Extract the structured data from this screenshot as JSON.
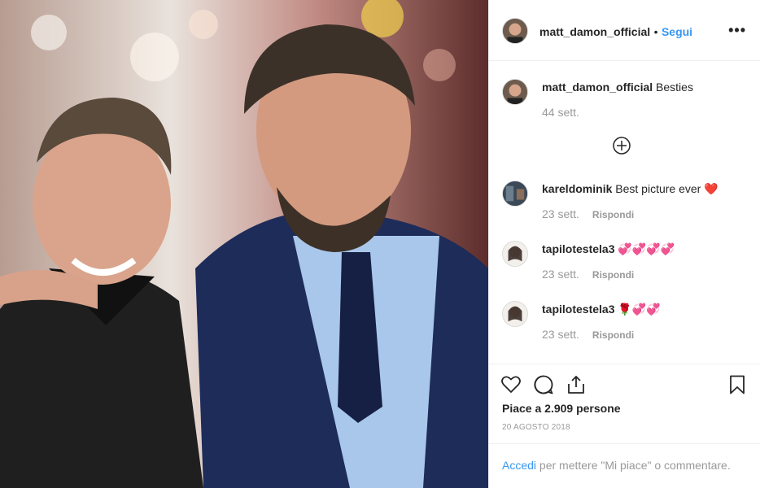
{
  "post": {
    "username": "matt_damon_official",
    "separator": "•",
    "follow_label": "Segui",
    "more_label": "•••",
    "caption_user": "matt_damon_official",
    "caption_text": "Besties",
    "caption_age": "44 sett."
  },
  "comments": [
    {
      "user": "kareldominik",
      "text": "Best picture ever ❤️",
      "age": "23 sett.",
      "reply": "Rispondi"
    },
    {
      "user": "tapilotestela3",
      "text": "💞💞💞💞",
      "age": "23 sett.",
      "reply": "Rispondi"
    },
    {
      "user": "tapilotestela3",
      "text": "🌹💞💞",
      "age": "23 sett.",
      "reply": "Rispondi"
    }
  ],
  "icons": {
    "like": "heart-icon",
    "comment": "comment-bubble-icon",
    "share": "share-icon",
    "save": "bookmark-icon",
    "load_more": "plus-circle-icon"
  },
  "stats": {
    "likes_text": "Piace a 2.909 persone",
    "date_text": "20 AGOSTO 2018"
  },
  "login": {
    "link": "Accedi",
    "rest": " per mettere \"Mi piace\" o commentare."
  },
  "colors": {
    "accent": "#3897f0",
    "muted": "#999999",
    "text": "#262626",
    "border": "#efefef"
  }
}
